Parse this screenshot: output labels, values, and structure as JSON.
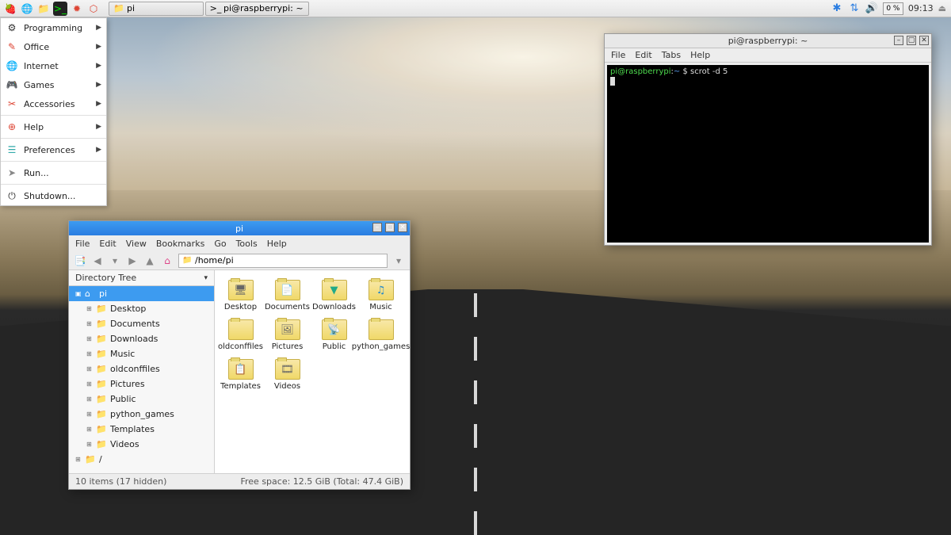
{
  "taskbar": {
    "launchers": [
      {
        "name": "raspberry-menu-icon",
        "glyph": "🍓",
        "bg": ""
      },
      {
        "name": "web-browser-icon",
        "glyph": "🌐",
        "bg": ""
      },
      {
        "name": "file-manager-icon",
        "glyph": "📁",
        "bg": ""
      },
      {
        "name": "terminal-icon",
        "glyph": ">_",
        "bg": "#222",
        "fg": "#0e0"
      },
      {
        "name": "mathematica-icon",
        "glyph": "✹",
        "bg": "",
        "fg": "#d43"
      },
      {
        "name": "wolfram-icon",
        "glyph": "⬡",
        "bg": "",
        "fg": "#d43"
      }
    ],
    "windows": [
      {
        "name": "taskbar-window-pi",
        "icon": "folder-icon",
        "glyph": "📁",
        "label": "pi"
      },
      {
        "name": "taskbar-window-terminal",
        "icon": "terminal-icon",
        "glyph": ">_",
        "label": "pi@raspberrypi: ~"
      }
    ],
    "tray": {
      "bluetooth": "✱",
      "network": "⇅",
      "volume": "🔊",
      "cpu": "0 %",
      "clock": "09:13",
      "eject": "⏏"
    }
  },
  "app_menu": {
    "items": [
      {
        "name": "menu-programming",
        "icon": "⚙",
        "label": "Programming",
        "arrow": true
      },
      {
        "name": "menu-office",
        "icon": "✎",
        "label": "Office",
        "arrow": true,
        "icolor": "#d43"
      },
      {
        "name": "menu-internet",
        "icon": "🌐",
        "label": "Internet",
        "arrow": true,
        "icolor": "#2a7de1"
      },
      {
        "name": "menu-games",
        "icon": "🎮",
        "label": "Games",
        "arrow": true,
        "icolor": "#3a3"
      },
      {
        "name": "menu-accessories",
        "icon": "✂",
        "label": "Accessories",
        "arrow": true,
        "icolor": "#d43"
      },
      {
        "sep": true
      },
      {
        "name": "menu-help",
        "icon": "⊕",
        "label": "Help",
        "arrow": true,
        "icolor": "#d43"
      },
      {
        "sep": true
      },
      {
        "name": "menu-preferences",
        "icon": "☰",
        "label": "Preferences",
        "arrow": true,
        "icolor": "#3aa"
      },
      {
        "sep": true
      },
      {
        "name": "menu-run",
        "icon": "➤",
        "label": "Run...",
        "arrow": false,
        "icolor": "#888"
      },
      {
        "sep": true
      },
      {
        "name": "menu-shutdown",
        "icon": "⏻",
        "label": "Shutdown...",
        "arrow": false
      }
    ]
  },
  "fm": {
    "title": "pi",
    "menubar": [
      "File",
      "Edit",
      "View",
      "Bookmarks",
      "Go",
      "Tools",
      "Help"
    ],
    "path": "/home/pi",
    "side_title": "Directory Tree",
    "tree_root": {
      "label": "pi",
      "icon": "⌂"
    },
    "tree_children": [
      {
        "label": "Desktop"
      },
      {
        "label": "Documents"
      },
      {
        "label": "Downloads"
      },
      {
        "label": "Music"
      },
      {
        "label": "oldconffiles"
      },
      {
        "label": "Pictures"
      },
      {
        "label": "Public"
      },
      {
        "label": "python_games"
      },
      {
        "label": "Templates"
      },
      {
        "label": "Videos"
      }
    ],
    "tree_root2": {
      "label": "/",
      "icon": "📁"
    },
    "files": [
      {
        "label": "Desktop",
        "emblem": "🖥"
      },
      {
        "label": "Documents",
        "emblem": "📄"
      },
      {
        "label": "Downloads",
        "emblem": "▼",
        "ecolor": "#2a8"
      },
      {
        "label": "Music",
        "emblem": "♫",
        "ecolor": "#28c"
      },
      {
        "label": "oldconffiles",
        "emblem": ""
      },
      {
        "label": "Pictures",
        "emblem": "🖼"
      },
      {
        "label": "Public",
        "emblem": "📡"
      },
      {
        "label": "python_games",
        "emblem": ""
      },
      {
        "label": "Templates",
        "emblem": "📋"
      },
      {
        "label": "Videos",
        "emblem": "🎞"
      }
    ],
    "status_left": "10 items (17 hidden)",
    "status_right": "Free space: 12.5 GiB (Total: 47.4 GiB)"
  },
  "term": {
    "title": "pi@raspberrypi: ~",
    "menubar": [
      "File",
      "Edit",
      "Tabs",
      "Help"
    ],
    "prompt_user": "pi@raspberrypi",
    "prompt_sep": ":",
    "prompt_path": "~",
    "prompt_dollar": " $ ",
    "command": "scrot -d 5"
  }
}
